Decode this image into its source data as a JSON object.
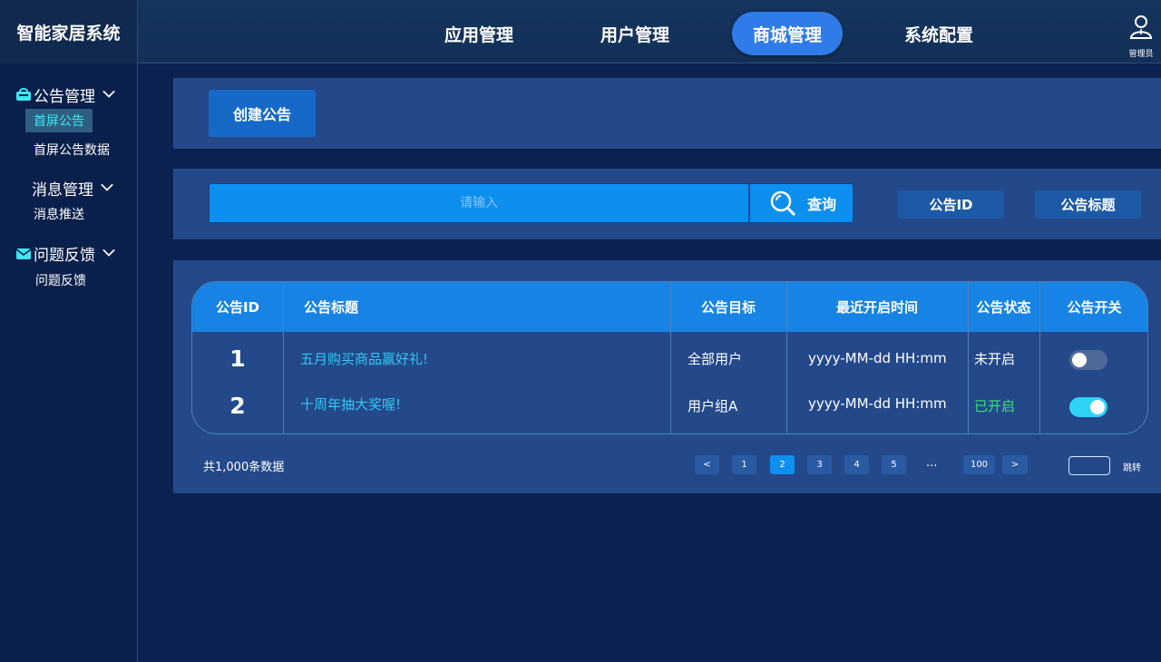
{
  "app": {
    "title": "智能家居系统"
  },
  "nav": {
    "tabs": [
      {
        "label": "应用管理",
        "active": false
      },
      {
        "label": "用户管理",
        "active": false
      },
      {
        "label": "商城管理",
        "active": true
      },
      {
        "label": "系统配置",
        "active": false
      }
    ],
    "user_label": "管理员"
  },
  "sidebar": {
    "groups": [
      {
        "label": "公告管理",
        "icon": "bag-icon",
        "items": [
          {
            "label": "首屏公告",
            "active": true
          },
          {
            "label": "首屏公告数据",
            "active": false
          }
        ]
      },
      {
        "label": "消息管理",
        "icon": "",
        "items": [
          {
            "label": "消息推送",
            "active": false
          }
        ]
      },
      {
        "label": "问题反馈",
        "icon": "mail-icon",
        "items": [
          {
            "label": "问题反馈",
            "active": false
          }
        ]
      }
    ]
  },
  "toolbar": {
    "create_label": "创建公告"
  },
  "search": {
    "placeholder": "请输入",
    "button_label": "查询",
    "filters": [
      "公告ID",
      "公告标题"
    ]
  },
  "table": {
    "columns": [
      "公告ID",
      "公告标题",
      "公告目标",
      "最近开启时间",
      "公告状态",
      "公告开关"
    ],
    "rows": [
      {
        "id": "1",
        "title": "五月购买商品赢好礼!",
        "target": "全部用户",
        "time": "yyyy-MM-dd HH:mm",
        "status": "未开启",
        "status_color": "#ffffff",
        "switch_on": false
      },
      {
        "id": "2",
        "title": "十周年抽大奖喔!",
        "target": "用户组A",
        "time": "yyyy-MM-dd HH:mm",
        "status": "已开启",
        "status_color": "#3de07a",
        "switch_on": true
      }
    ]
  },
  "pagination": {
    "total_text": "共1,000条数据",
    "prev": "<",
    "next": ">",
    "pages": [
      "1",
      "2",
      "3",
      "4",
      "5"
    ],
    "current": "2",
    "ellipsis": "...",
    "last": "100",
    "jump_label": "跳转"
  },
  "colors": {
    "accent": "#2f7be8",
    "panel": "#23498a",
    "header_row": "#1783e5",
    "link": "#32c7f0",
    "success": "#3de07a"
  }
}
